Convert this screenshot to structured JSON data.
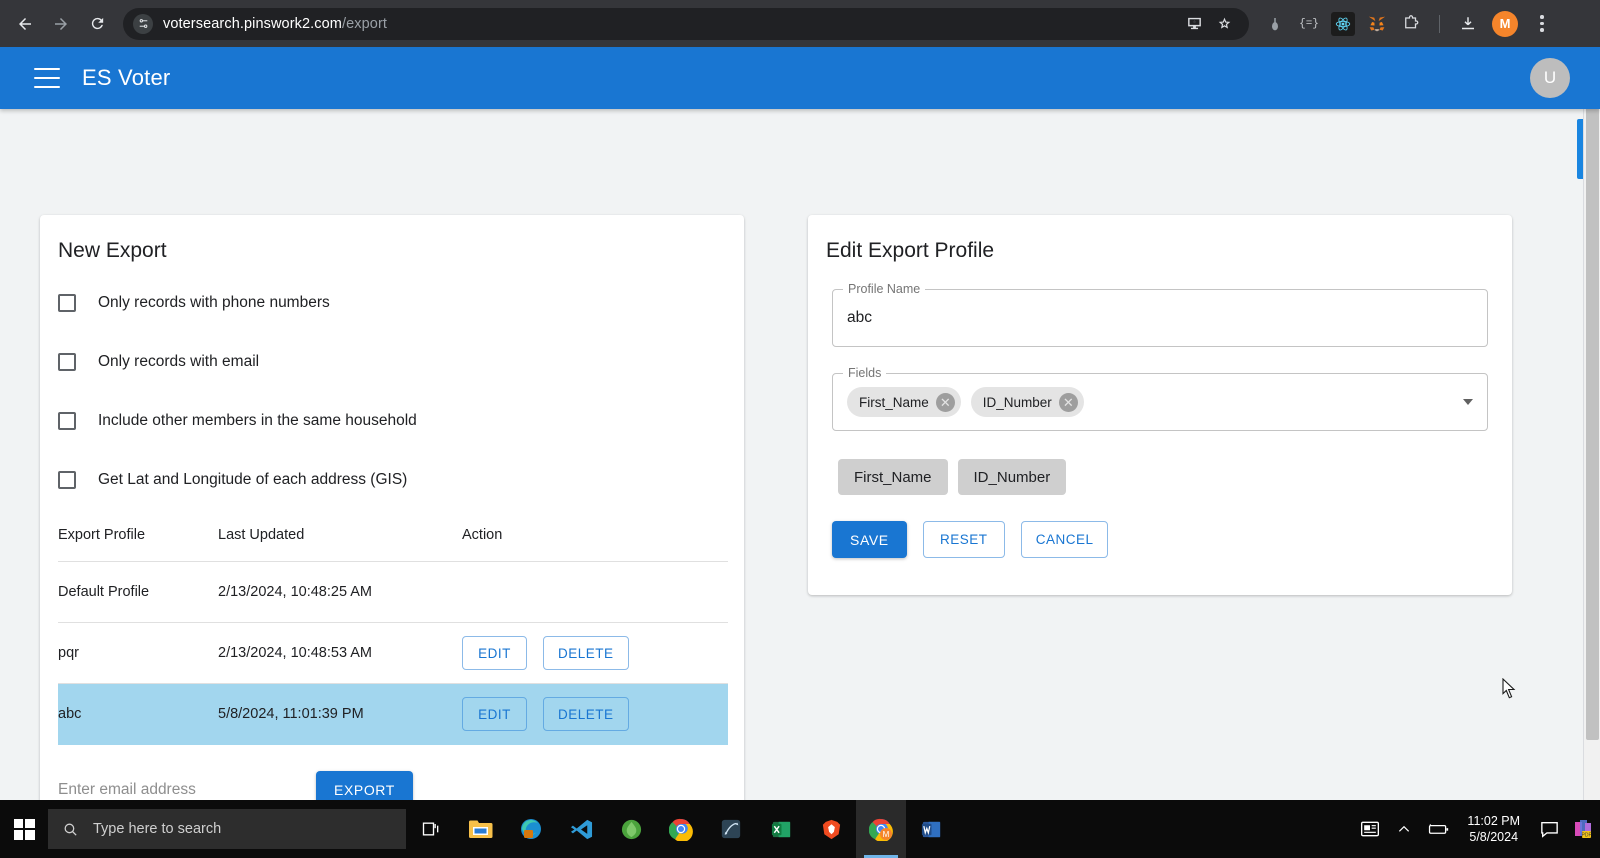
{
  "browser": {
    "back_icon": "back-arrow-icon",
    "forward_icon": "forward-arrow-icon",
    "reload_icon": "reload-icon",
    "site_info_icon": "site-settings-icon",
    "url_domain": "votersearch.pinswork2.com",
    "url_path": "/export",
    "install_icon": "install-app-icon",
    "bookmark_icon": "star-bookmark-icon",
    "extensions": [
      {
        "name": "color-picker-extension-icon",
        "glyph": ""
      },
      {
        "name": "json-formatter-extension-icon",
        "glyph": "{=}"
      },
      {
        "name": "react-devtools-extension-icon",
        "glyph": ""
      },
      {
        "name": "metamask-extension-icon",
        "glyph": ""
      },
      {
        "name": "extensions-puzzle-icon",
        "glyph": ""
      }
    ],
    "download_icon": "downloads-icon",
    "profile_initial": "M",
    "menu_icon": "chrome-menu-icon"
  },
  "appbar": {
    "menu_icon": "hamburger-menu-icon",
    "title": "ES Voter",
    "avatar_initial": "U"
  },
  "new_export": {
    "title": "New Export",
    "options": [
      "Only records with phone numbers",
      "Only records with email",
      "Include other members in the same household",
      "Get Lat and Longitude of each address (GIS)"
    ],
    "table": {
      "headers": [
        "Export Profile",
        "Last Updated",
        "Action"
      ],
      "rows": [
        {
          "profile": "Default Profile",
          "updated": "2/13/2024, 10:48:25 AM",
          "actions": [],
          "selected": false
        },
        {
          "profile": "pqr",
          "updated": "2/13/2024, 10:48:53 AM",
          "actions": [
            "EDIT",
            "DELETE"
          ],
          "selected": false
        },
        {
          "profile": "abc",
          "updated": "5/8/2024, 11:01:39 PM",
          "actions": [
            "EDIT",
            "DELETE"
          ],
          "selected": true
        }
      ]
    },
    "email_placeholder": "Enter email address",
    "email_value": "",
    "export_button": "EXPORT"
  },
  "edit_profile": {
    "title": "Edit Export Profile",
    "profile_name_label": "Profile Name",
    "profile_name_value": "abc",
    "fields_label": "Fields",
    "selected_chips": [
      "First_Name",
      "ID_Number"
    ],
    "chip_remove_glyph": "✕",
    "dropdown_icon": "chevron-down-icon",
    "preview_chips": [
      "First_Name",
      "ID_Number"
    ],
    "save_label": "SAVE",
    "reset_label": "RESET",
    "cancel_label": "CANCEL"
  },
  "taskbar": {
    "start_icon": "windows-start-icon",
    "search_icon": "search-icon",
    "search_placeholder": "Type here to search",
    "apps": [
      {
        "name": "task-view-icon"
      },
      {
        "name": "file-explorer-icon"
      },
      {
        "name": "microsoft-edge-icon"
      },
      {
        "name": "vs-code-icon"
      },
      {
        "name": "mongodb-icon"
      },
      {
        "name": "google-chrome-icon"
      },
      {
        "name": "pen-tool-app-icon"
      },
      {
        "name": "microsoft-excel-icon"
      },
      {
        "name": "brave-browser-icon"
      },
      {
        "name": "chrome-profile-window-icon"
      },
      {
        "name": "microsoft-word-icon"
      }
    ],
    "tray": {
      "news_icon": "news-and-interests-icon",
      "overflow_icon": "show-hidden-icons-icon",
      "battery_icon": "battery-icon",
      "time": "11:02 PM",
      "date": "5/8/2024",
      "notification_icon": "action-center-icon",
      "app_icon": "colorful-app-icon"
    }
  },
  "colors": {
    "accent": "#1976d2",
    "selected_row": "#a2d6ee",
    "appbar": "#1976d2",
    "page_bg": "#f1f3f4"
  }
}
